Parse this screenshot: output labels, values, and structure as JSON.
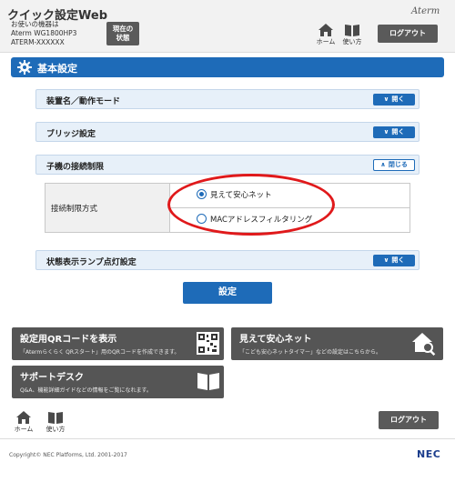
{
  "header": {
    "app_title": "クイック設定Web",
    "device_label": "お使いの機器は",
    "model": "Aterm WG1800HP3",
    "device_name": "ATERM-XXXXXX",
    "status_button_line1": "現在の",
    "status_button_line2": "状態",
    "brand": "Aterm",
    "home_label": "ホーム",
    "help_label": "使い方",
    "logout_label": "ログアウト"
  },
  "section": {
    "title": "基本設定"
  },
  "accordions": [
    {
      "label": "装置名／動作モード",
      "toggle": "開く",
      "state": "collapsed"
    },
    {
      "label": "ブリッジ設定",
      "toggle": "開く",
      "state": "collapsed"
    },
    {
      "label": "子機の接続制限",
      "toggle": "閉じる",
      "state": "expanded"
    },
    {
      "label": "状態表示ランプ点灯設定",
      "toggle": "開く",
      "state": "collapsed"
    }
  ],
  "connection_limit": {
    "field_label": "接続制限方式",
    "options": [
      {
        "label": "見えて安心ネット",
        "checked": true
      },
      {
        "label": "MACアドレスフィルタリング",
        "checked": false
      }
    ]
  },
  "submit_label": "設定",
  "tiles": {
    "qr": {
      "title": "設定用QRコードを表示",
      "desc": "「Atermらくらく QRスタート」用のQRコードを作成できます。"
    },
    "safe_net": {
      "title": "見えて安心ネット",
      "desc": "「こども安心ネットタイマー」などの設定はこちらから。"
    },
    "support": {
      "title": "サポートデスク",
      "desc": "Q&A、機能詳細ガイドなどの情報をご覧になれます。"
    }
  },
  "footer": {
    "home_label": "ホーム",
    "help_label": "使い方",
    "logout_label": "ログアウト",
    "copyright": "Copyright© NEC Platforms, Ltd. 2001-2017",
    "logo": "NEC"
  },
  "colors": {
    "accent_blue": "#1e6bb8",
    "tile_gray": "#555555",
    "highlight_red": "#e0191b"
  }
}
